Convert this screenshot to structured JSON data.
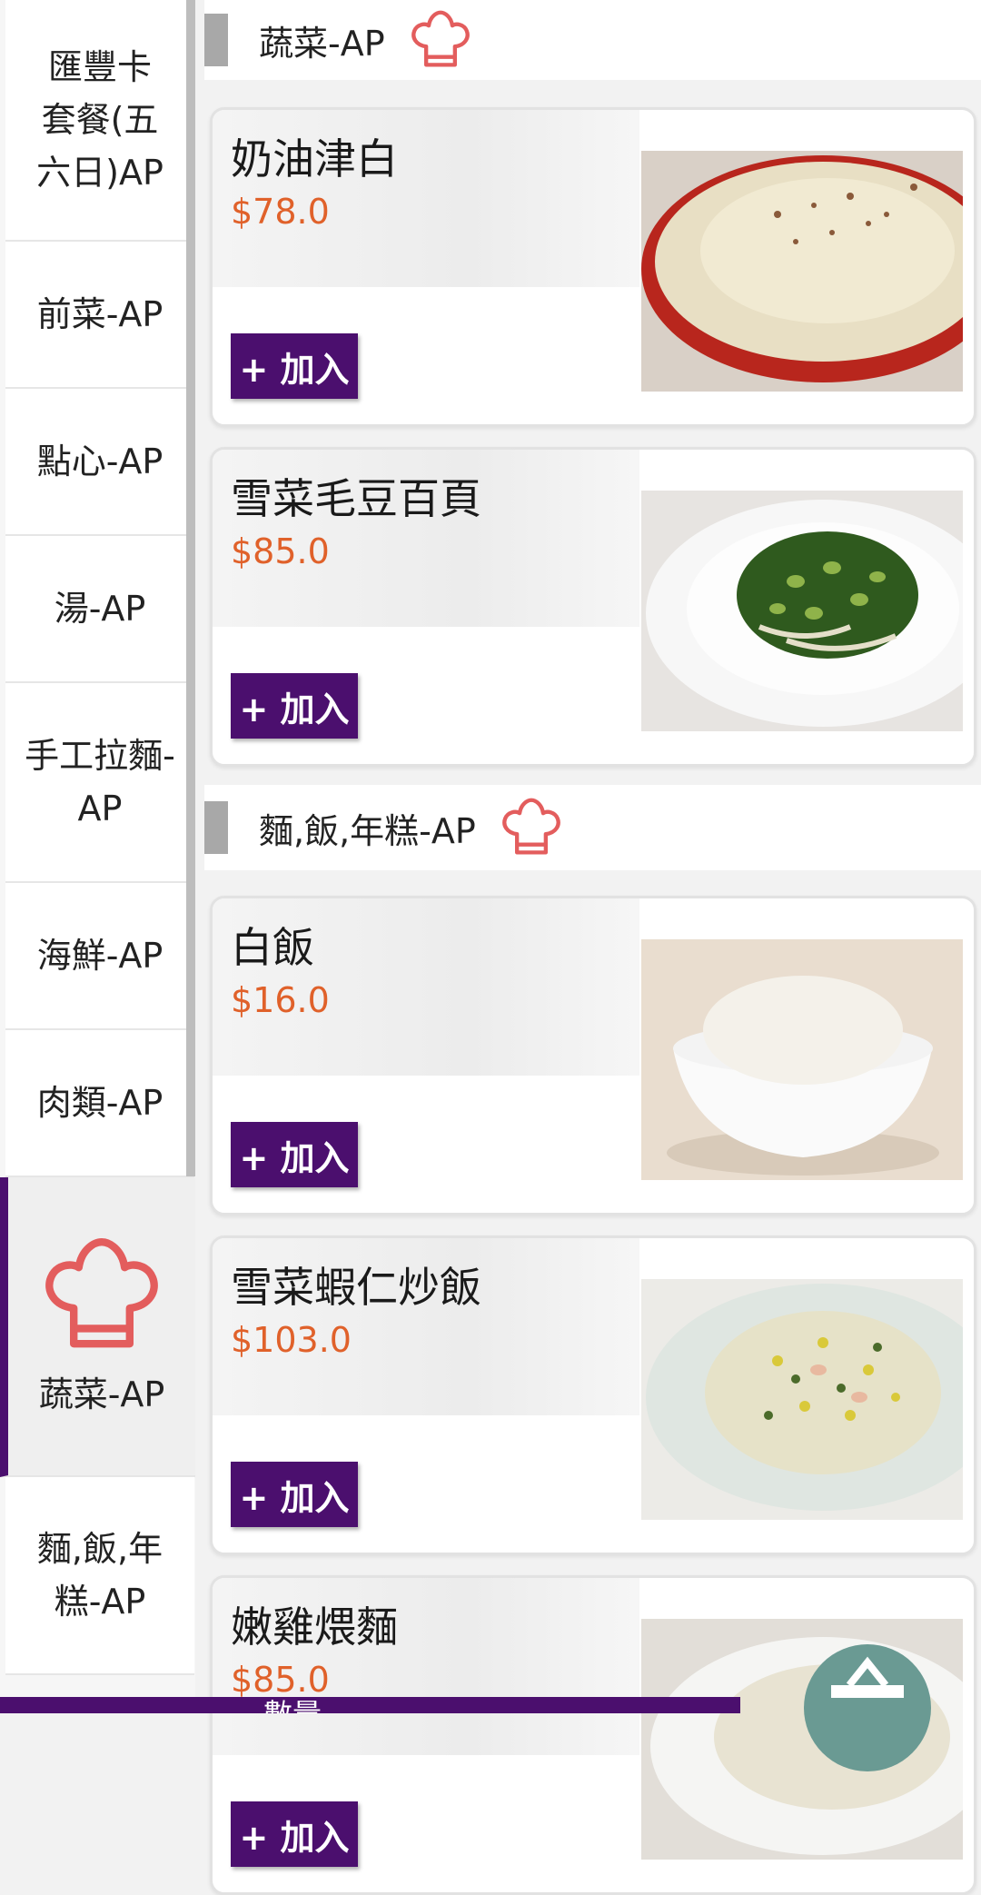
{
  "sidebar": {
    "categories": [
      {
        "label": "匯豐卡套餐(五六日)AP"
      },
      {
        "label": "前菜-AP"
      },
      {
        "label": "點心-AP"
      },
      {
        "label": "湯-AP"
      },
      {
        "label": "手工拉麵-AP"
      },
      {
        "label": "海鮮-AP"
      },
      {
        "label": "肉類-AP"
      },
      {
        "label": "蔬菜-AP",
        "active": true,
        "icon": "chef-hat-icon"
      },
      {
        "label": "麵,飯,年糕-AP"
      }
    ]
  },
  "sections": [
    {
      "title": "蔬菜-AP",
      "icon": "chef-hat-icon",
      "items": [
        {
          "name": "奶油津白",
          "price": "$78.0",
          "add_label": "+ 加入"
        },
        {
          "name": "雪菜毛豆百頁",
          "price": "$85.0",
          "add_label": "+ 加入"
        }
      ]
    },
    {
      "title": "麵,飯,年糕-AP",
      "icon": "chef-hat-icon",
      "items": [
        {
          "name": "白飯",
          "price": "$16.0",
          "add_label": "+ 加入"
        },
        {
          "name": "雪菜蝦仁炒飯",
          "price": "$103.0",
          "add_label": "+ 加入"
        },
        {
          "name": "嫩雞煨麵",
          "price": "$85.0",
          "add_label": "+ 加入"
        }
      ]
    }
  ],
  "bottom_bar": {
    "label": "數量"
  },
  "colors": {
    "accent": "#4b0f6e",
    "price": "#e0612a",
    "icon": "#e35d5d"
  }
}
